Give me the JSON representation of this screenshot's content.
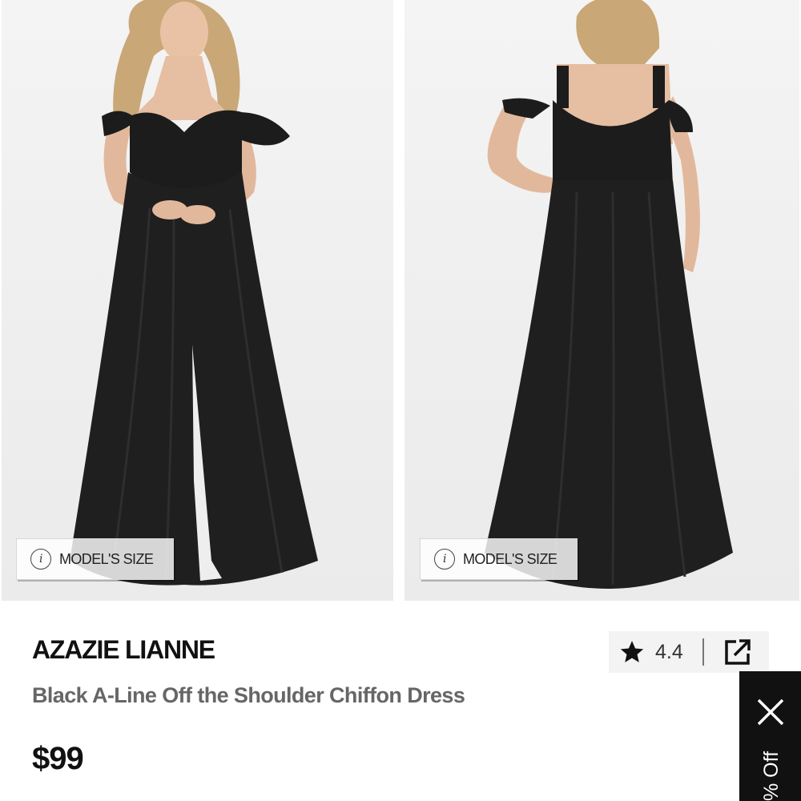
{
  "gallery": {
    "images": [
      {
        "name": "front-view",
        "badge_label": "MODEL'S SIZE"
      },
      {
        "name": "back-view",
        "badge_label": "MODEL'S SIZE"
      }
    ]
  },
  "product": {
    "brand": "AZAZIE LIANNE",
    "name": "Black A-Line Off the Shoulder Chiffon Dress",
    "price": "$99"
  },
  "rating": {
    "value": "4.4",
    "icon": "star-icon",
    "share_icon": "share-icon"
  },
  "promo": {
    "text": "% Off",
    "close_icon": "close-icon"
  },
  "colors": {
    "dress": "#1c1c1c",
    "background": "#f0f0f0",
    "promo_bg": "#111111",
    "subtitle": "#666666"
  }
}
